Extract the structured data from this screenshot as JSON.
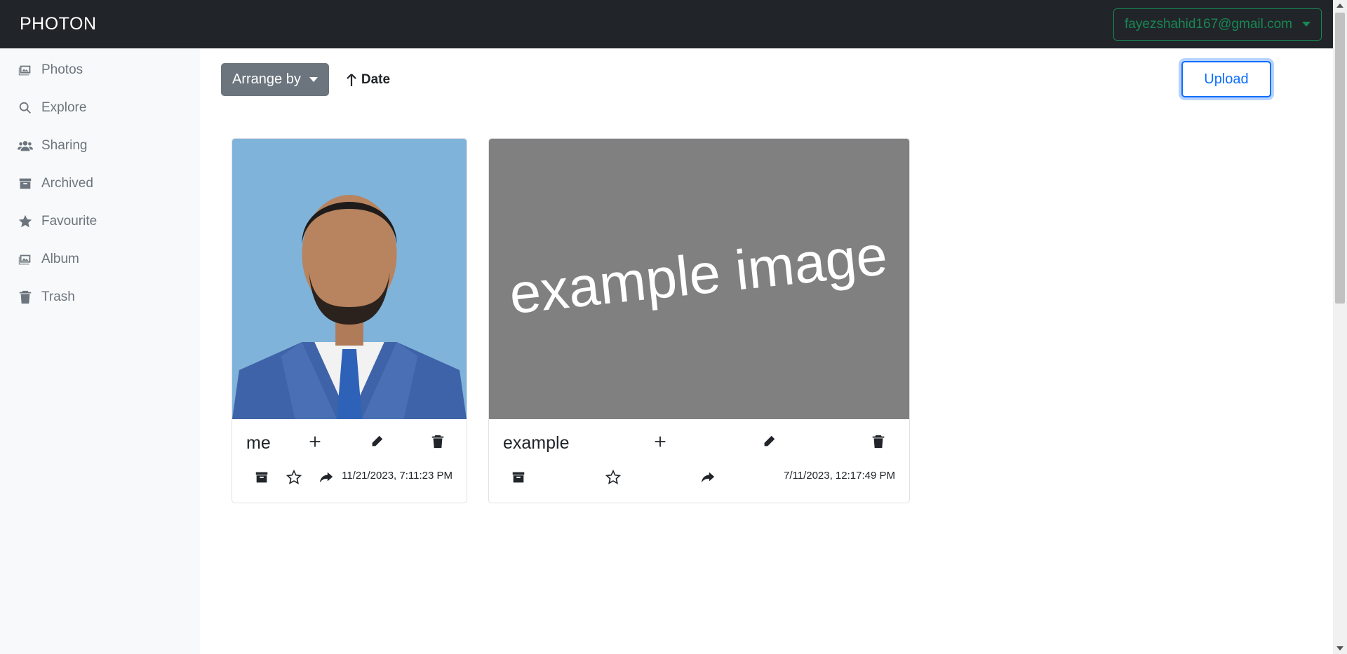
{
  "app": {
    "brand": "PHOTON"
  },
  "header": {
    "user_email": "fayezshahid167@gmail.com"
  },
  "sidebar": {
    "items": [
      {
        "label": "Photos",
        "icon": "images-icon"
      },
      {
        "label": "Explore",
        "icon": "search-icon"
      },
      {
        "label": "Sharing",
        "icon": "users-icon"
      },
      {
        "label": "Archived",
        "icon": "archive-icon"
      },
      {
        "label": "Favourite",
        "icon": "star-icon"
      },
      {
        "label": "Album",
        "icon": "images-icon"
      },
      {
        "label": "Trash",
        "icon": "trash-icon"
      }
    ]
  },
  "toolbar": {
    "arrange_label": "Arrange by",
    "sort_label": "Date",
    "sort_direction": "ascending",
    "upload_label": "Upload"
  },
  "photos": [
    {
      "title": "me",
      "timestamp": "11/21/2023, 7:11:23 PM",
      "image": "portrait of a man in a blue suit"
    },
    {
      "title": "example",
      "timestamp": "7/11/2023, 12:17:49 PM",
      "image_text": "example image"
    }
  ],
  "colors": {
    "navbar": "#212529",
    "sidebar": "#f8f9fa",
    "accent": "#0d6efd",
    "user_outline": "#198754",
    "arrange_button": "#6c757d",
    "placeholder_bg": "#808080"
  }
}
